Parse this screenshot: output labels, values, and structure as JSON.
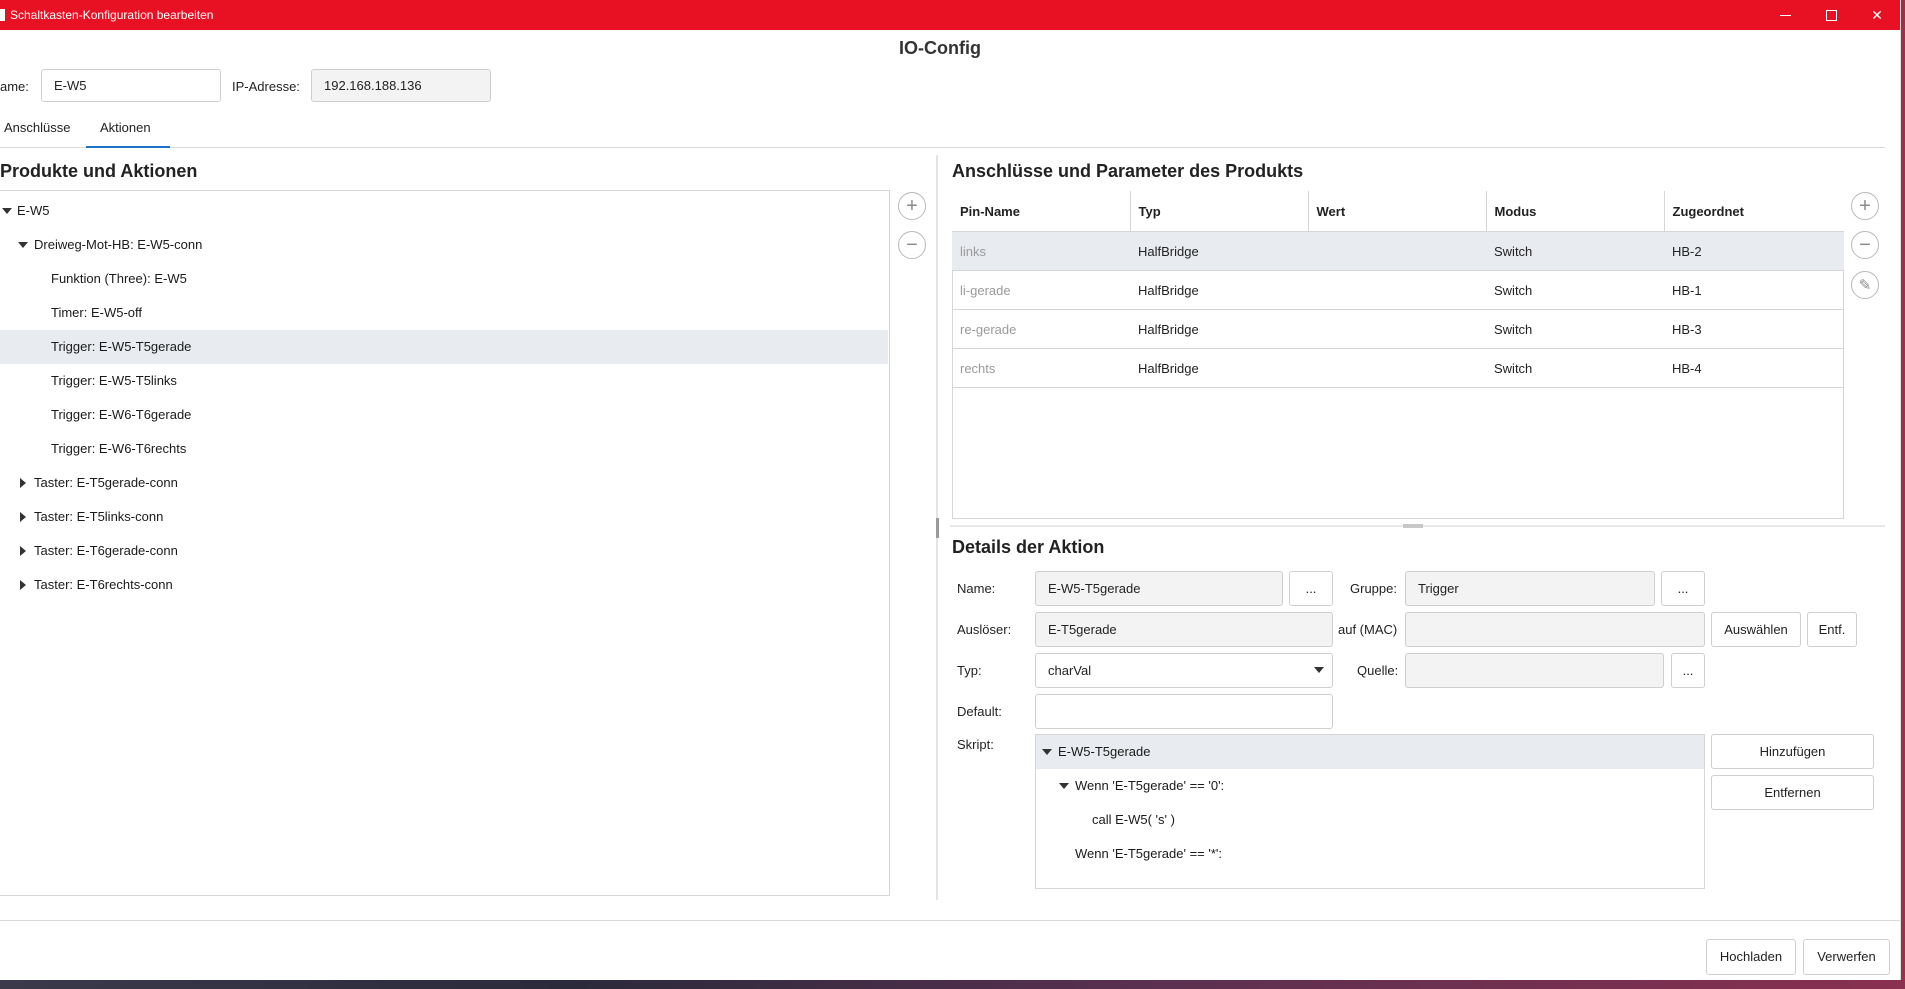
{
  "window": {
    "title": "Schaltkasten-Konfiguration bearbeiten",
    "controls": {
      "minimize": "minimize-icon",
      "maximize": "maximize-icon",
      "close": "close-icon"
    }
  },
  "page": {
    "heading": "IO-Config"
  },
  "header": {
    "name_label": "ame:",
    "name_value": "E-W5",
    "ip_label": "IP-Adresse:",
    "ip_value": "192.168.188.136"
  },
  "tabs": [
    {
      "label": "Anschlüsse",
      "active": false
    },
    {
      "label": "Aktionen",
      "active": true
    }
  ],
  "left": {
    "title": "Produkte und Aktionen",
    "tree": [
      {
        "label": "E-W5",
        "level": 0,
        "expanded": true
      },
      {
        "label": "Dreiweg-Mot-HB: E-W5-conn",
        "level": 1,
        "expanded": true
      },
      {
        "label": "Funktion (Three): E-W5",
        "level": 2
      },
      {
        "label": "Timer: E-W5-off",
        "level": 2
      },
      {
        "label": "Trigger: E-W5-T5gerade",
        "level": 2,
        "selected": true
      },
      {
        "label": "Trigger: E-W5-T5links",
        "level": 2
      },
      {
        "label": "Trigger: E-W6-T6gerade",
        "level": 2
      },
      {
        "label": "Trigger: E-W6-T6rechts",
        "level": 2
      },
      {
        "label": "Taster: E-T5gerade-conn",
        "level": 1,
        "expanded": false
      },
      {
        "label": "Taster: E-T5links-conn",
        "level": 1,
        "expanded": false
      },
      {
        "label": "Taster: E-T6gerade-conn",
        "level": 1,
        "expanded": false
      },
      {
        "label": "Taster: E-T6rechts-conn",
        "level": 1,
        "expanded": false
      }
    ],
    "buttons": {
      "add": "+",
      "remove": "−"
    }
  },
  "right": {
    "pins_title": "Anschlüsse und Parameter des Produkts",
    "columns": [
      "Pin-Name",
      "Typ",
      "Wert",
      "Modus",
      "Zugeordnet"
    ],
    "rows": [
      {
        "pin": "links",
        "typ": "HalfBridge",
        "wert": "",
        "modus": "Switch",
        "zugeordnet": "HB-2",
        "selected": true
      },
      {
        "pin": "li-gerade",
        "typ": "HalfBridge",
        "wert": "",
        "modus": "Switch",
        "zugeordnet": "HB-1"
      },
      {
        "pin": "re-gerade",
        "typ": "HalfBridge",
        "wert": "",
        "modus": "Switch",
        "zugeordnet": "HB-3"
      },
      {
        "pin": "rechts",
        "typ": "HalfBridge",
        "wert": "",
        "modus": "Switch",
        "zugeordnet": "HB-4"
      }
    ],
    "pin_buttons": {
      "add": "+",
      "remove": "−",
      "edit": "✎"
    }
  },
  "details": {
    "title": "Details der Aktion",
    "name_label": "Name:",
    "name_value": "E-W5-T5gerade",
    "dots": "...",
    "gruppe_label": "Gruppe:",
    "gruppe_value": "Trigger",
    "ausloeser_label": "Auslöser:",
    "ausloeser_value": "E-T5gerade",
    "mac_label": "auf (MAC)",
    "mac_value": "",
    "auswaehlen": "Auswählen",
    "entf": "Entf.",
    "typ_label": "Typ:",
    "typ_value": "charVal",
    "quelle_label": "Quelle:",
    "quelle_value": "",
    "default_label": "Default:",
    "default_value": "",
    "skript_label": "Skript:",
    "script": [
      {
        "text": "E-W5-T5gerade",
        "level": 0,
        "expanded": true,
        "selected": true
      },
      {
        "text": "Wenn 'E-T5gerade' == '0':",
        "level": 1,
        "expanded": true
      },
      {
        "text": "call E-W5( 's' )",
        "level": 2
      },
      {
        "text": "Wenn 'E-T5gerade' == '*':",
        "level": 1
      }
    ],
    "hinzufuegen": "Hinzufügen",
    "entfernen": "Entfernen"
  },
  "footer": {
    "upload": "Hochladen",
    "discard": "Verwerfen"
  }
}
